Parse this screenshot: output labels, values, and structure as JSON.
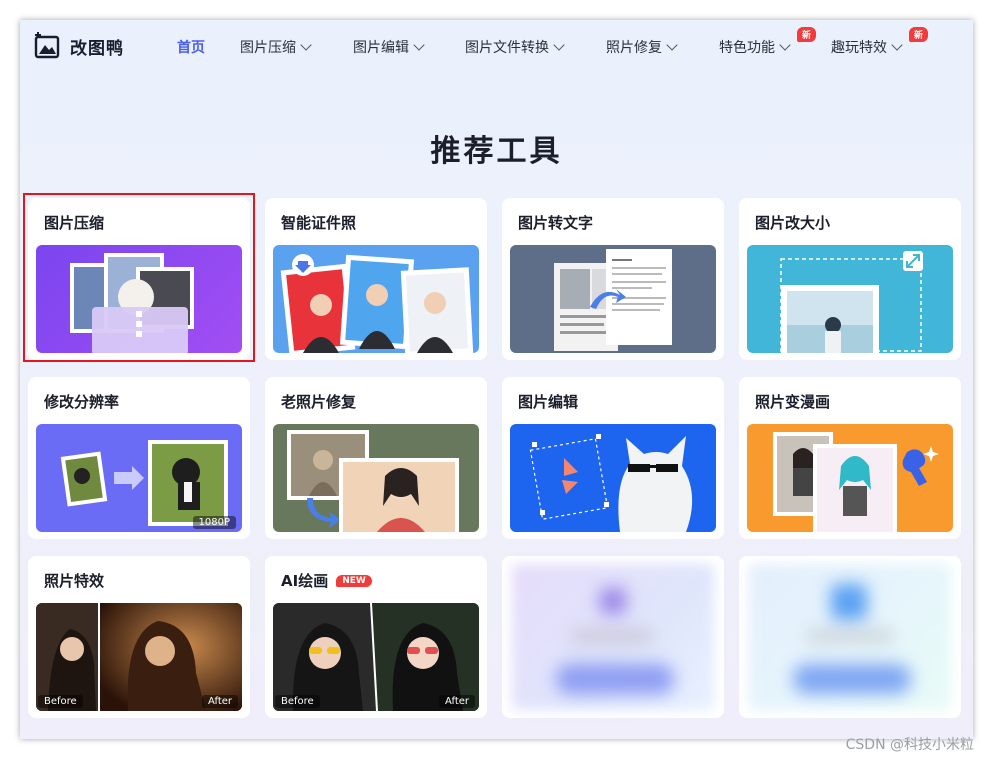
{
  "brand": {
    "name": "改图鸭"
  },
  "nav": {
    "items": [
      {
        "label": "首页",
        "active": true,
        "dropdown": false,
        "badge": ""
      },
      {
        "label": "图片压缩",
        "active": false,
        "dropdown": true,
        "badge": ""
      },
      {
        "label": "图片编辑",
        "active": false,
        "dropdown": true,
        "badge": ""
      },
      {
        "label": "图片文件转换",
        "active": false,
        "dropdown": true,
        "badge": ""
      },
      {
        "label": "照片修复",
        "active": false,
        "dropdown": true,
        "badge": ""
      },
      {
        "label": "特色功能",
        "active": false,
        "dropdown": true,
        "badge": "新"
      },
      {
        "label": "趣玩特效",
        "active": false,
        "dropdown": true,
        "badge": "新"
      }
    ]
  },
  "section": {
    "title": "推荐工具"
  },
  "tools": [
    {
      "title": "图片压缩",
      "tag": "",
      "highlighted": true
    },
    {
      "title": "智能证件照",
      "tag": ""
    },
    {
      "title": "图片转文字",
      "tag": ""
    },
    {
      "title": "图片改大小",
      "tag": ""
    },
    {
      "title": "修改分辨率",
      "tag": "",
      "resolution_label": "1080P"
    },
    {
      "title": "老照片修复",
      "tag": ""
    },
    {
      "title": "图片编辑",
      "tag": ""
    },
    {
      "title": "照片变漫画",
      "tag": ""
    },
    {
      "title": "照片特效",
      "tag": "",
      "before_label": "Before",
      "after_label": "After"
    },
    {
      "title": "AI绘画",
      "tag": "NEW",
      "before_label": "Before",
      "after_label": "After"
    }
  ],
  "watermark": "CSDN @科技小米粒",
  "colors": {
    "accent": "#4a5df0",
    "badge": "#f23c3c",
    "highlight_border": "#e4161c"
  }
}
